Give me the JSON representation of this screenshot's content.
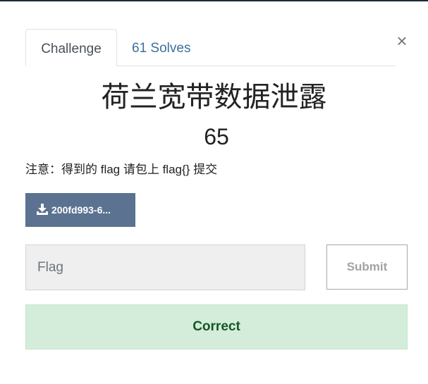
{
  "tabs": {
    "challenge_label": "Challenge",
    "solves_label": "61 Solves"
  },
  "close_label": "×",
  "challenge": {
    "name": "荷兰宽带数据泄露",
    "value": "65",
    "description": "注意：得到的 flag 请包上 flag{} 提交"
  },
  "file": {
    "label": "200fd993-6..."
  },
  "flag_input": {
    "placeholder": "Flag",
    "value": ""
  },
  "submit_label": "Submit",
  "result_message": "Correct",
  "colors": {
    "tab_link": "#3d6f9c",
    "file_button": "#5b7290",
    "success_bg": "#d4edda",
    "success_text": "#155724"
  },
  "icons": {
    "file": "download-icon",
    "close": "close-icon"
  }
}
